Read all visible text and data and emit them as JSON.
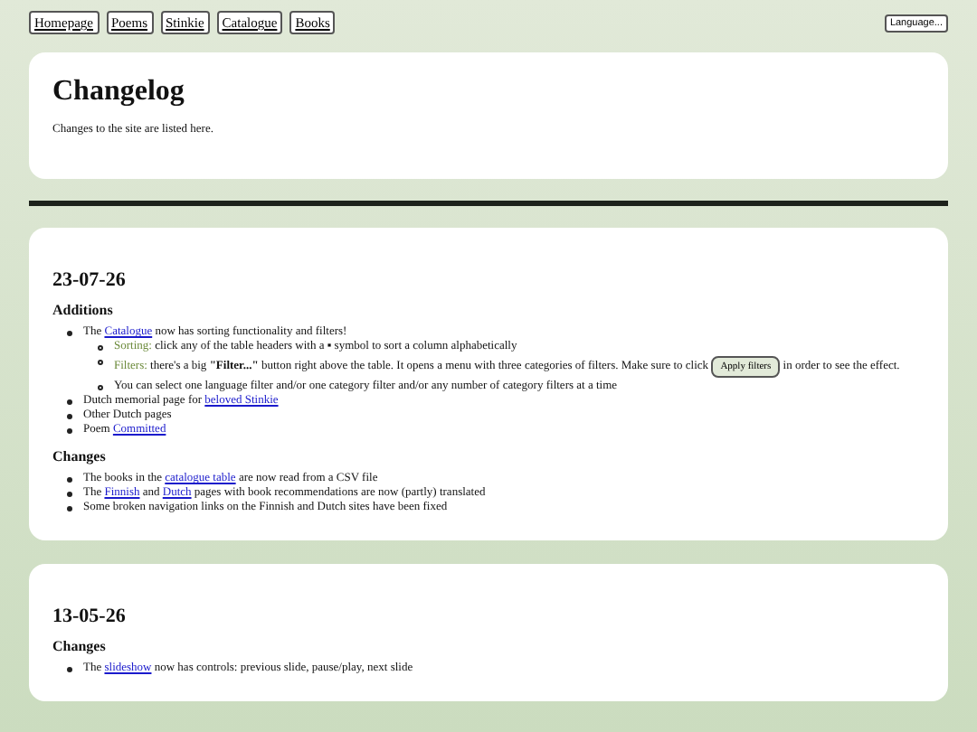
{
  "nav": {
    "links": [
      "Homepage",
      "Poems",
      "Stinkie",
      "Catalogue",
      "Books"
    ],
    "language_button": "Language..."
  },
  "header": {
    "title": "Changelog",
    "intro": "Changes to the site are listed here."
  },
  "entries": [
    {
      "date": "23-07-26",
      "sections": [
        {
          "heading": "Additions",
          "items": [
            {
              "parts": [
                {
                  "kind": "text",
                  "text": "The "
                },
                {
                  "kind": "link",
                  "text": "Catalogue"
                },
                {
                  "kind": "text",
                  "text": " now has sorting functionality and filters!"
                }
              ],
              "children": [
                {
                  "parts": [
                    {
                      "kind": "label",
                      "text": "Sorting:"
                    },
                    {
                      "kind": "text",
                      "text": " click any of the table headers with a ▪ symbol to sort a column alphabetically"
                    }
                  ]
                },
                {
                  "parts": [
                    {
                      "kind": "label",
                      "text": "Filters:"
                    },
                    {
                      "kind": "text",
                      "text": " there's a big **\"Filter...\"** button right above the table. It opens a menu with three categories of filters. Make sure to click "
                    },
                    {
                      "kind": "button",
                      "text": "Apply filters"
                    },
                    {
                      "kind": "text",
                      "text": " in order to see the effect."
                    }
                  ]
                },
                {
                  "parts": [
                    {
                      "kind": "text",
                      "text": "You can select one language filter and/or one category filter and/or any number of category filters at a time"
                    }
                  ]
                }
              ]
            },
            {
              "parts": [
                {
                  "kind": "text",
                  "text": "Dutch memorial page for "
                },
                {
                  "kind": "link",
                  "text": "beloved Stinkie"
                }
              ]
            },
            {
              "parts": [
                {
                  "kind": "text",
                  "text": "Other Dutch pages"
                }
              ]
            },
            {
              "parts": [
                {
                  "kind": "text",
                  "text": "Poem "
                },
                {
                  "kind": "link",
                  "text": "Committed"
                }
              ]
            }
          ]
        },
        {
          "heading": "Changes",
          "items": [
            {
              "parts": [
                {
                  "kind": "text",
                  "text": "The books in the "
                },
                {
                  "kind": "link",
                  "text": "catalogue table"
                },
                {
                  "kind": "text",
                  "text": " are now read from a CSV file"
                }
              ]
            },
            {
              "parts": [
                {
                  "kind": "text",
                  "text": "The "
                },
                {
                  "kind": "link",
                  "text": "Finnish"
                },
                {
                  "kind": "text",
                  "text": " and "
                },
                {
                  "kind": "link",
                  "text": "Dutch"
                },
                {
                  "kind": "text",
                  "text": " pages with book recommendations are now (partly) translated"
                }
              ]
            },
            {
              "parts": [
                {
                  "kind": "text",
                  "text": "Some broken navigation links on the Finnish and Dutch sites have been fixed"
                }
              ]
            }
          ]
        }
      ]
    },
    {
      "date": "13-05-26",
      "sections": [
        {
          "heading": "Changes",
          "items": [
            {
              "parts": [
                {
                  "kind": "text",
                  "text": "The "
                },
                {
                  "kind": "link",
                  "text": "slideshow"
                },
                {
                  "kind": "text",
                  "text": " now has controls: previous slide, pause/play, next slide"
                }
              ]
            }
          ]
        }
      ]
    }
  ]
}
